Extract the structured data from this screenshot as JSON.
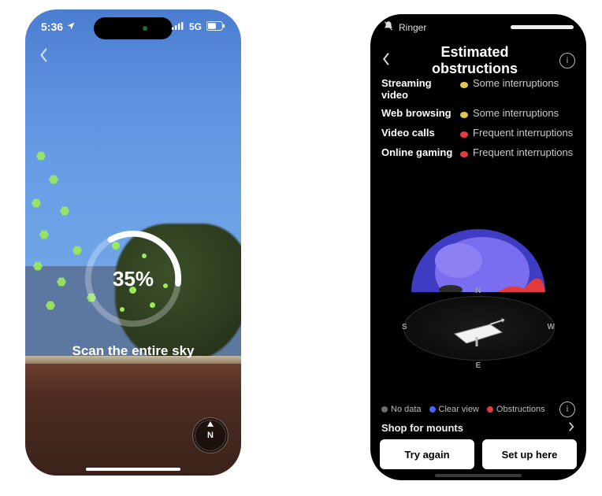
{
  "phoneA": {
    "status": {
      "time": "5:36",
      "network": "5G"
    },
    "progress_pct": 35,
    "progress_text": "35%",
    "instruction": "Scan the entire sky",
    "compass_label": "N",
    "ring_rotation_deg": -30
  },
  "phoneB": {
    "status": {
      "ringer_label": "Ringer"
    },
    "title": "Estimated obstructions",
    "metrics": [
      {
        "label": "Streaming video",
        "status": "Some interruptions",
        "color": "#e3c94a"
      },
      {
        "label": "Web browsing",
        "status": "Some interruptions",
        "color": "#e3c94a"
      },
      {
        "label": "Video calls",
        "status": "Frequent interruptions",
        "color": "#e23b3b"
      },
      {
        "label": "Online gaming",
        "status": "Frequent interruptions",
        "color": "#e23b3b"
      }
    ],
    "compass": {
      "n": "N",
      "e": "E",
      "s": "S",
      "w": "W"
    },
    "legend": {
      "no_data": {
        "label": "No data",
        "color": "#6d6d6d"
      },
      "clear": {
        "label": "Clear view",
        "color": "#4a62ff"
      },
      "obstruction": {
        "label": "Obstructions",
        "color": "#e23b3b"
      }
    },
    "shop_label": "Shop for mounts",
    "buttons": {
      "retry": "Try again",
      "setup": "Set up here"
    }
  }
}
